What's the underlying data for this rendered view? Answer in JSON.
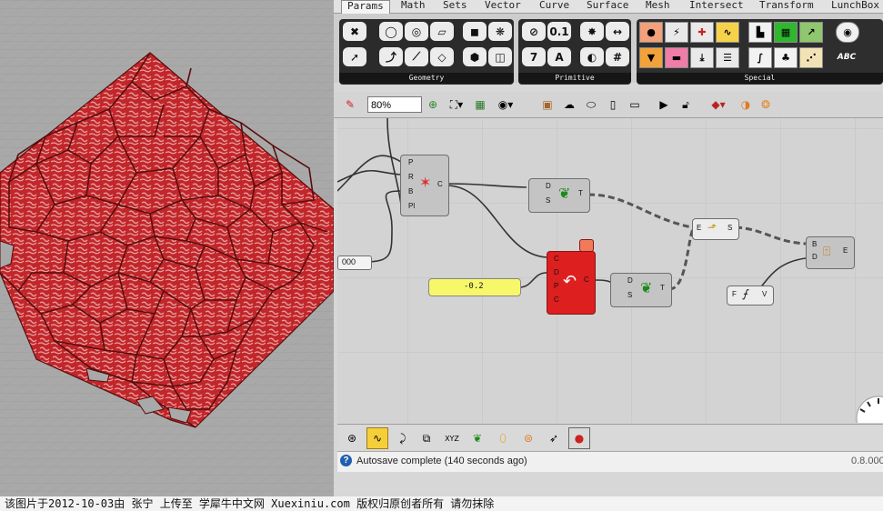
{
  "tabs": [
    "Params",
    "Math",
    "Sets",
    "Vector",
    "Curve",
    "Surface",
    "Mesh",
    "Intersect",
    "Transform",
    "LunchBox"
  ],
  "ribbon": {
    "geometry_label": "Geometry",
    "primitive_label": "Primitive",
    "special_label": "Special",
    "primitive_icons": {
      "num": "0.1",
      "seven": "7",
      "letter": "A"
    },
    "special_text": {
      "abc": "ABC"
    }
  },
  "toolbar": {
    "zoom": "80%"
  },
  "canvas": {
    "slider_value": "-0.2",
    "number_box": "000",
    "comp_a_ports": [
      "P",
      "R",
      "B",
      "Pl"
    ],
    "comp_a_out": "C",
    "comp_b_ports": [
      "D",
      "S"
    ],
    "comp_b_out": "T",
    "comp_c_ports": [
      "C",
      "D",
      "P",
      "C"
    ],
    "comp_c_out": "C",
    "comp_d_ports": [
      "D",
      "S"
    ],
    "comp_d_out": "T",
    "comp_e_in": "E",
    "comp_e_out": "S",
    "comp_f_ports": [
      "B",
      "D"
    ],
    "comp_f_out": "E",
    "comp_g_in": "F",
    "comp_g_out": "V"
  },
  "bottom": {
    "xyz": "XYZ"
  },
  "status": {
    "message": "Autosave complete (140 seconds ago)",
    "version": "0.8.000"
  },
  "caption": "该图片于2012-10-03由 张宁 上传至 学犀牛中文网 Xuexiniu.com 版权归原创者所有 请勿抹除",
  "colors": {
    "red_component": "#dd1f1f",
    "slider": "#f7f76a",
    "mesh_fill": "#c2262a",
    "mesh_line": "#5a0c0c"
  }
}
